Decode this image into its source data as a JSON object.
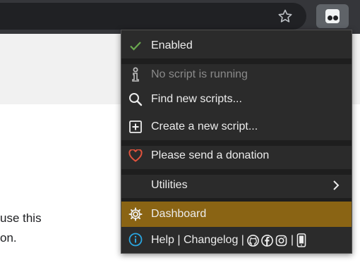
{
  "browser": {
    "bookmark_icon": "star-icon",
    "extension_icon": "tampermonkey-icon"
  },
  "page": {
    "line1": "use this",
    "line2": "on."
  },
  "menu": {
    "enabled": {
      "label": "Enabled",
      "icon": "checkmark-icon",
      "color": "#6aa84f"
    },
    "no_script": {
      "label": "No script is running",
      "icon": "info-icon"
    },
    "find": {
      "label": "Find new scripts...",
      "icon": "search-icon"
    },
    "create": {
      "label": "Create a new script...",
      "icon": "plus-square-icon"
    },
    "donate": {
      "label": "Please send a donation",
      "icon": "heart-icon",
      "color": "#e0533d"
    },
    "utilities": {
      "label": "Utilities",
      "icon": "chevron-right-icon"
    },
    "dashboard": {
      "label": "Dashboard",
      "icon": "gear-icon",
      "highlight": "#8a6414"
    },
    "footer": {
      "help": "Help",
      "sep1": " | ",
      "changelog": "Changelog",
      "sep2": " | ",
      "sep3": " | ",
      "help_icon": "info-circle-icon",
      "social_icons": [
        "github-icon",
        "facebook-icon",
        "instagram-icon"
      ],
      "mobile_icon": "phone-icon"
    }
  }
}
